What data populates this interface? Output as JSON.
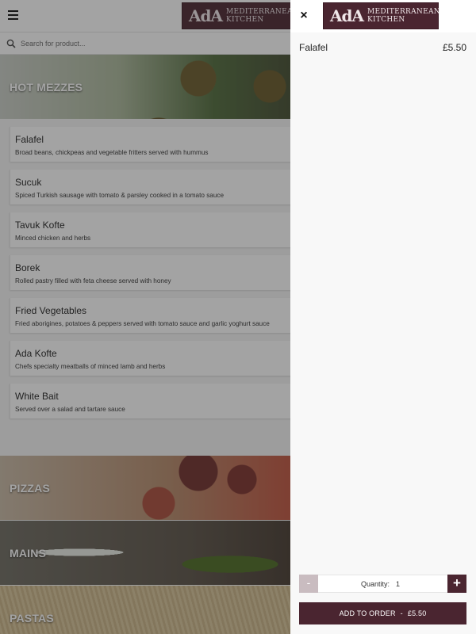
{
  "brand": {
    "logo_mark": "AdA",
    "logo_line1": "MEDITERRANEAN",
    "logo_line2": "KITCHEN"
  },
  "search": {
    "placeholder": "Search for product..."
  },
  "categories": {
    "hot_mezzes": "HOT MEZZES",
    "pizzas": "PIZZAS",
    "mains": "MAINS",
    "pastas": "PASTAS"
  },
  "menu_items": [
    {
      "name": "Falafel",
      "description": "Broad beans, chickpeas and vegetable fritters served with hummus"
    },
    {
      "name": "Sucuk",
      "description": "Spiced Turkish sausage with tomato & parsley cooked in a tomato sauce"
    },
    {
      "name": "Tavuk Kofte",
      "description": "Minced chicken and herbs"
    },
    {
      "name": "Borek",
      "description": "Rolled pastry filled with feta cheese served with honey"
    },
    {
      "name": "Fried Vegetables",
      "description": "Fried aborigines, potatoes & peppers served with tomato sauce and garlic yoghurt sauce"
    },
    {
      "name": "Ada Kofte",
      "description": "Chefs specialty meatballs of minced lamb and herbs"
    },
    {
      "name": "White Bait",
      "description": "Served over a salad and tartare sauce"
    }
  ],
  "panel": {
    "close_symbol": "×",
    "product_name": "Falafel",
    "product_price": "£5.50",
    "quantity_label": "Quantity:",
    "quantity_value": "1",
    "minus_symbol": "-",
    "plus_symbol": "+",
    "add_label": "ADD TO ORDER",
    "add_separator": "-",
    "add_price": "£5.50"
  },
  "colors": {
    "brand": "#4a2530",
    "minus_disabled": "#c9bcc0",
    "overlay": "rgba(35,35,35,0.42)"
  },
  "icons": [
    "hamburger-icon",
    "search-icon",
    "close-icon",
    "minus-icon",
    "plus-icon"
  ]
}
